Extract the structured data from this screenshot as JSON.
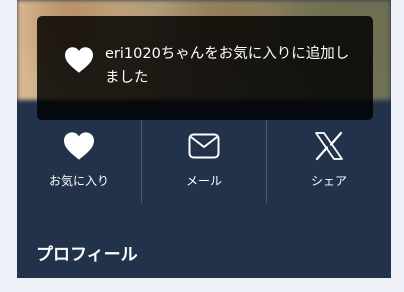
{
  "toast": {
    "message": "eri1020ちゃんをお気に入りに追加しました",
    "icon": "heart-icon"
  },
  "actions": [
    {
      "label": "お気に入り",
      "icon": "heart-icon"
    },
    {
      "label": "メール",
      "icon": "mail-icon"
    },
    {
      "label": "シェア",
      "icon": "x-logo-icon"
    }
  ],
  "profile": {
    "section_title": "プロフィール"
  },
  "colors": {
    "card_background": "#22324a",
    "page_background": "#eef1f8",
    "toast_background": "#000000",
    "text": "#ffffff"
  }
}
